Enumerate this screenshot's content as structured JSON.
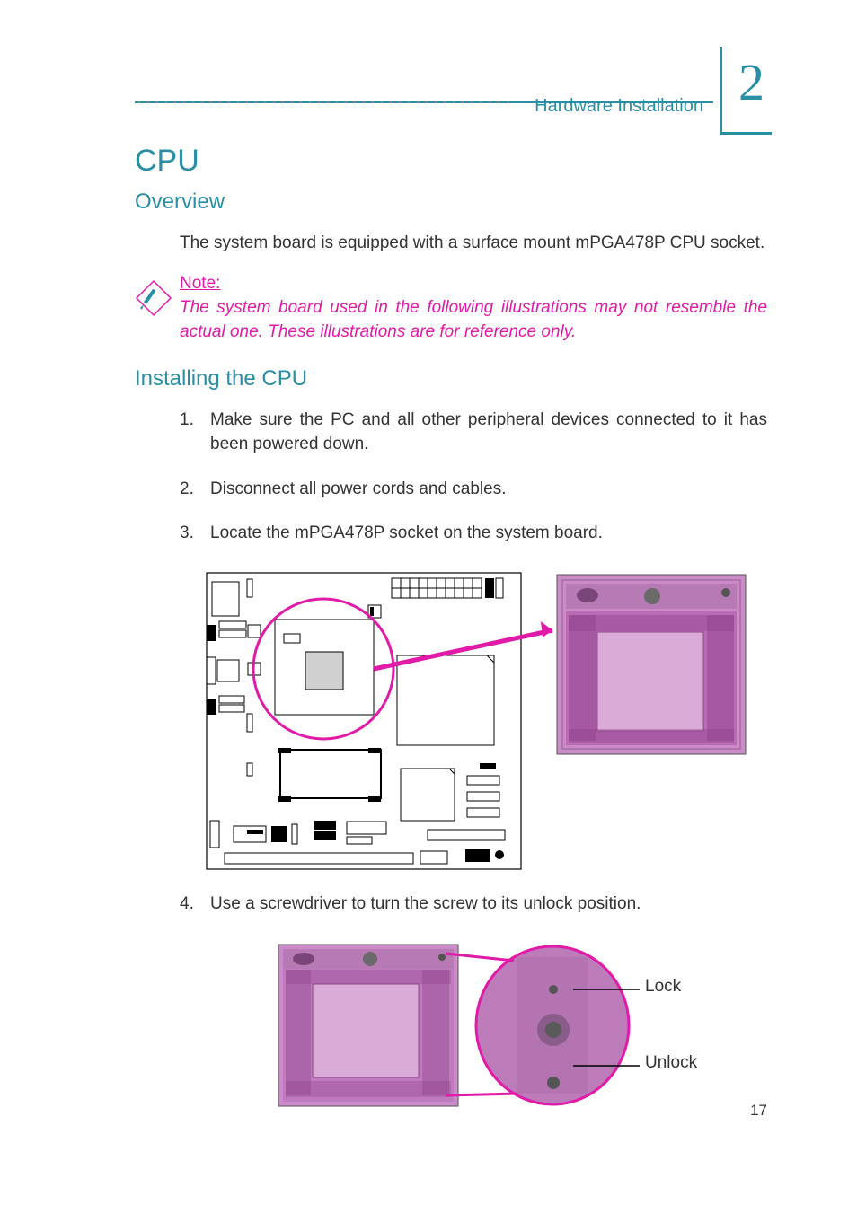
{
  "header": {
    "chapter_title": "Hardware Installation",
    "chapter_number": "2"
  },
  "section_title": "CPU",
  "subsection_overview_title": "Overview",
  "overview_text": "The system board is equipped with a surface mount mPGA478P CPU socket.",
  "note": {
    "label": "Note:",
    "body": "The system board used in the following illustrations may not resemble the actual one. These illustrations are for reference only."
  },
  "subsection_install_title": "Installing the CPU",
  "steps": {
    "1": {
      "num": "1.",
      "text": "Make sure the PC and all other peripheral devices connected to it has been powered down."
    },
    "2": {
      "num": "2.",
      "text": "Disconnect all power cords and cables."
    },
    "3": {
      "num": "3.",
      "text": "Locate the mPGA478P socket on the system board."
    },
    "4": {
      "num": "4.",
      "text": "Use a screwdriver to turn the screw to its unlock position."
    }
  },
  "diagram2_labels": {
    "lock": "Lock",
    "unlock": "Unlock"
  },
  "page_number": "17",
  "icons": {
    "note": "note-pencil-icon"
  }
}
